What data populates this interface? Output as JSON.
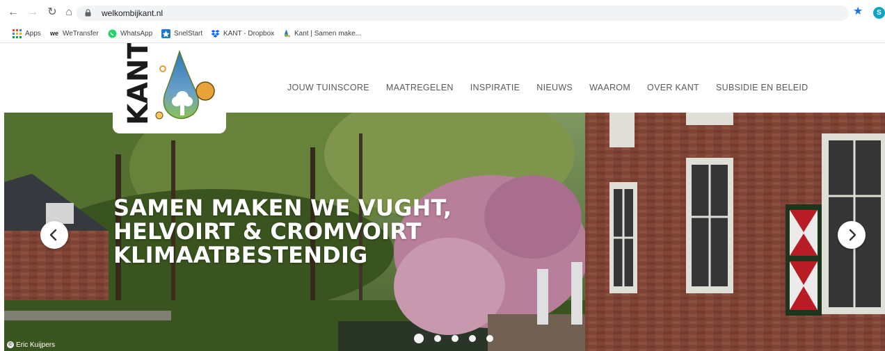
{
  "browser": {
    "url": "welkombijkant.nl",
    "profile_initial": "S",
    "bookmarks": [
      {
        "label": "Apps",
        "icon": "apps-grid-icon"
      },
      {
        "label": "WeTransfer",
        "icon": "wetransfer-icon"
      },
      {
        "label": "WhatsApp",
        "icon": "whatsapp-icon"
      },
      {
        "label": "SnelStart",
        "icon": "snelstart-icon"
      },
      {
        "label": "KANT - Dropbox",
        "icon": "dropbox-icon"
      },
      {
        "label": "Kant | Samen make...",
        "icon": "kant-favicon-icon"
      }
    ],
    "accent": "#1a73e8"
  },
  "site": {
    "logo_text": "KANT",
    "nav": [
      "JOUW TUINSCORE",
      "MAATREGELEN",
      "INSPIRATIE",
      "NIEUWS",
      "WAAROM",
      "OVER KANT",
      "SUBSIDIE EN BELEID"
    ],
    "hero": {
      "headline": [
        "SAMEN MAKEN WE VUGHT,",
        "HELVOIRT & CROMVOIRT",
        "KLIMAATBESTENDIG"
      ],
      "credit": "Eric Kuijpers",
      "slide_count": 5,
      "active_slide": 1
    },
    "colors": {
      "nav_text": "#5a5a5a",
      "logo_drop_blue": "#2f78b8",
      "logo_green": "#7ab648",
      "logo_orange": "#e8a33a"
    }
  }
}
